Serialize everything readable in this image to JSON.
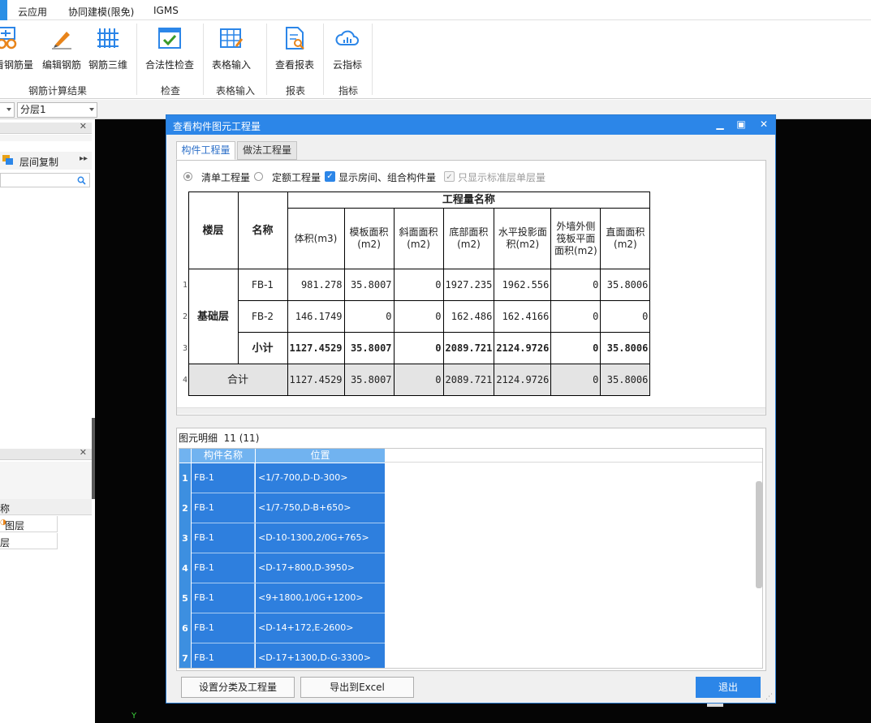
{
  "menu": {
    "items": [
      "云应用",
      "协同建模(限免)",
      "IGMS"
    ]
  },
  "ribbon": {
    "buttons": [
      "查看钢筋量",
      "编辑钢筋",
      "钢筋三维",
      "合法性检查",
      "表格输入",
      "查看报表",
      "云指标"
    ],
    "button_first_visible": "看钢筋量",
    "groups": [
      "钢筋计算结果",
      "检查",
      "表格输入",
      "报表",
      "指标"
    ]
  },
  "layerbar": {
    "floor_combo": "",
    "layer_combo": "分层1"
  },
  "leftpanel": {
    "copy_label": "层间复制",
    "col_header": "称",
    "row1": "图层",
    "row2": "层"
  },
  "dialog": {
    "title": "查看构件图元工程量",
    "tabs": [
      "构件工程量",
      "做法工程量"
    ],
    "options": {
      "radio_qingdan": "清单工程量",
      "radio_dinge": "定额工程量",
      "chk_show_rooms": "显示房间、组合构件量",
      "chk_std_floor": "只显示标准层单层量"
    },
    "table": {
      "col_floor": "楼层",
      "col_name": "名称",
      "group_header": "工程量名称",
      "cols": [
        "体积(m3)",
        "模板面积(m2)",
        "斜面面积(m2)",
        "底部面积(m2)",
        "水平投影面积(m2)",
        "外墙外侧筏板平面面积(m2)",
        "直面面积(m2)"
      ],
      "floor": "基础层",
      "total_label": "合计",
      "rows": [
        {
          "n": "1",
          "name": "FB-1",
          "v": [
            "981.278",
            "35.8007",
            "0",
            "1927.235",
            "1962.556",
            "0",
            "35.8006"
          ]
        },
        {
          "n": "2",
          "name": "FB-2",
          "v": [
            "146.1749",
            "0",
            "0",
            "162.486",
            "162.4166",
            "0",
            "0"
          ]
        },
        {
          "n": "3",
          "name": "小计",
          "v": [
            "1127.4529",
            "35.8007",
            "0",
            "2089.721",
            "2124.9726",
            "0",
            "35.8006"
          ]
        },
        {
          "n": "4",
          "name": "合计",
          "v": [
            "1127.4529",
            "35.8007",
            "0",
            "2089.721",
            "2124.9726",
            "0",
            "35.8006"
          ]
        }
      ]
    },
    "detail": {
      "title": "图元明细",
      "count": "11 (11)",
      "headers": [
        "构件名称",
        "位置"
      ],
      "rows": [
        {
          "n": "1",
          "name": "FB-1",
          "pos": "<1/7-700,D-D-300>"
        },
        {
          "n": "2",
          "name": "FB-1",
          "pos": "<1/7-750,D-B+650>"
        },
        {
          "n": "3",
          "name": "FB-1",
          "pos": "<D-10-1300,2/0G+765>"
        },
        {
          "n": "4",
          "name": "FB-1",
          "pos": "<D-17+800,D-3950>"
        },
        {
          "n": "5",
          "name": "FB-1",
          "pos": "<9+1800,1/0G+1200>"
        },
        {
          "n": "6",
          "name": "FB-1",
          "pos": "<D-14+172,E-2600>"
        },
        {
          "n": "7",
          "name": "FB-1",
          "pos": "<D-17+1300,D-G-3300>"
        }
      ]
    },
    "buttons": {
      "settings": "设置分类及工程量",
      "export": "导出到Excel",
      "exit": "退出"
    }
  },
  "canvas": {
    "axis_label": "Y"
  },
  "colors": {
    "accent": "#2c86e8",
    "selection": "#2e7fde",
    "canvas": "#050505"
  }
}
